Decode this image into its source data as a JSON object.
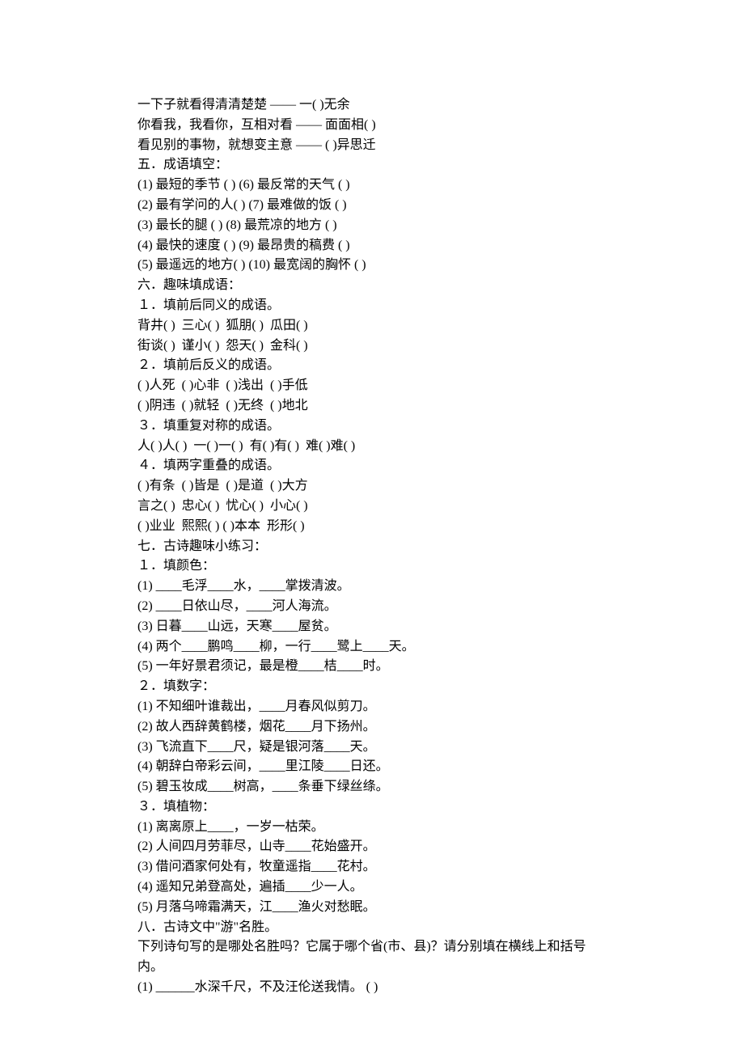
{
  "lines": [
    "一下子就看得清清楚楚 —— 一( )无余",
    "你看我，我看你，互相对看 —— 面面相( )",
    "看见别的事物，就想变主意 —— ( )异思迁",
    "五．成语填空：",
    "(1) 最短的季节 ( ) (6) 最反常的天气 ( )",
    "(2) 最有学问的人( ) (7) 最难做的饭 ( )",
    "(3) 最长的腿 ( ) (8) 最荒凉的地方 ( )",
    "(4) 最快的速度 ( ) (9) 最昂贵的稿费 ( )",
    "(5) 最遥远的地方( ) (10) 最宽阔的胸怀 ( )",
    "六．趣味填成语：",
    "１．填前后同义的成语。",
    "背井( )  三心( )  狐朋( )  瓜田( )",
    "街谈( )  谨小( )  怨天( )  金科( )",
    "２．填前后反义的成语。",
    "( )人死  ( )心非  ( )浅出  ( )手低",
    "( )阴违  ( )就轻  ( )无终  ( )地北",
    "３．填重复对称的成语。",
    "人( )人( )  一( )一( )  有( )有( )  难( )难( )",
    "４．填两字重叠的成语。",
    "( )有条  ( )皆是  ( )是道  ( )大方",
    "言之( )  忠心( )  忧心( )  小心( )",
    "( )业业  熙熙( ) ( )本本  形形( )",
    "七．古诗趣味小练习：",
    "１．填颜色：",
    "(1) ____毛浮____水，____掌拨清波。",
    "(2) ____日依山尽，____河人海流。",
    "(3) 日暮____山远，天寒____屋贫。",
    "(4) 两个____鹏鸣____柳，一行____鹭上____天。",
    "(5) 一年好景君须记，最是橙____桔____时。",
    "２．填数字：",
    "(1) 不知细叶谁裁出，____月春风似剪刀。",
    "(2) 故人西辞黄鹤楼，烟花____月下扬州。",
    "(3) 飞流直下____尺，疑是银河落____天。",
    "(4) 朝辞白帝彩云间，____里江陵____日还。",
    "(5) 碧玉妆成____树高，____条垂下绿丝绦。",
    "３．填植物：",
    "(1) 离离原上____，一岁一枯荣。",
    "(2) 人间四月劳菲尽，山寺____花始盛开。",
    "(3) 借问酒家何处有，牧童遥指____花村。",
    "(4) 遥知兄弟登高处，遍插____少一人。",
    "(5) 月落乌啼霜满天，江____渔火对愁眠。",
    "八．古诗文中\"游\"名胜。",
    "下列诗句写的是哪处名胜吗？它属于哪个省(市、县)？请分别填在横线上和括号内。",
    "(1) ______水深千尺，不及汪伦送我情。 ( )"
  ]
}
